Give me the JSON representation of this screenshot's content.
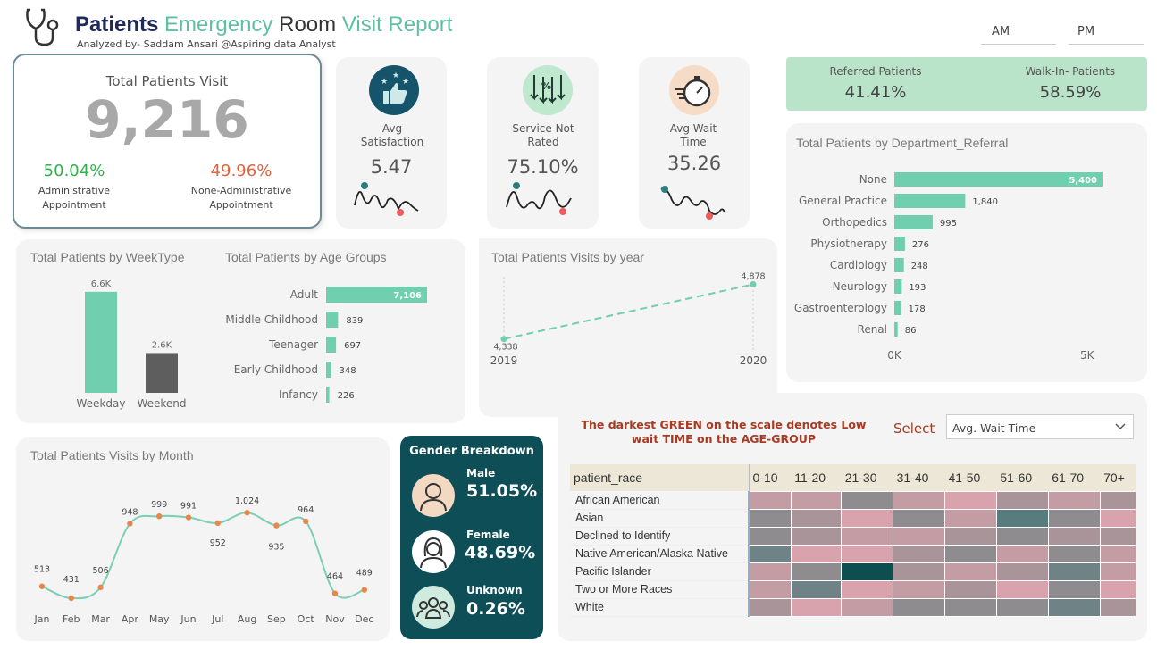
{
  "header": {
    "title_w1": "Patients",
    "title_w2": "Emergency",
    "title_w3": "Room",
    "title_w4": "Visit Report",
    "subtitle": "Analyzed by- Saddam Ansari @Aspiring data Analyst",
    "slicer_am": "AM",
    "slicer_pm": "PM",
    "colors": {
      "navy": "#1e2a5a",
      "teal": "#5fbfa4"
    }
  },
  "total": {
    "title": "Total Patients Visit",
    "value": "9,216",
    "admin_pct": "50.04%",
    "admin_label": "Administrative Appointment",
    "nonadmin_pct": "49.96%",
    "nonadmin_label": "None-Administrative Appointment"
  },
  "kpis": [
    {
      "label": "Avg Satisfaction",
      "value": "5.47",
      "icon": "thumbs-up-stars-icon"
    },
    {
      "label": "Service Not Rated",
      "value": "75.10%",
      "icon": "percent-arrows-icon"
    },
    {
      "label": "Avg Wait Time",
      "value": "35.26",
      "icon": "stopwatch-icon"
    }
  ],
  "referral": {
    "referred_label": "Referred Patients",
    "referred_value": "41.41%",
    "walkin_label": "Walk-In- Patients",
    "walkin_value": "58.59%"
  },
  "gender": {
    "title": "Gender Breakdown",
    "male_label": "Male",
    "male_value": "51.05%",
    "female_label": "Female",
    "female_value": "48.69%",
    "unknown_label": "Unknown",
    "unknown_value": "0.26%"
  },
  "heatmap": {
    "note": "The darkest GREEN on the scale denotes Low wait TIME on the AGE-GROUP",
    "select_label": "Select",
    "select_value": "Avg. Wait Time",
    "row_header": "patient_race",
    "columns": [
      "0-10",
      "11-20",
      "21-30",
      "31-40",
      "41-50",
      "51-60",
      "61-70",
      "70+"
    ],
    "rows": [
      "African American",
      "Asian",
      "Declined to Identify",
      "Native American/Alaska Native",
      "Pacific Islander",
      "Two or More Races",
      "White"
    ],
    "levels": [
      [
        2,
        2,
        4,
        2,
        1,
        3,
        2,
        3
      ],
      [
        4,
        3,
        1,
        4,
        2,
        6,
        4,
        1
      ],
      [
        4,
        3,
        2,
        2,
        3,
        4,
        3,
        3
      ],
      [
        5,
        1,
        1,
        3,
        4,
        2,
        4,
        2
      ],
      [
        2,
        4,
        7,
        3,
        2,
        3,
        5,
        2
      ],
      [
        2,
        5,
        1,
        2,
        3,
        1,
        4,
        1
      ],
      [
        3,
        1,
        2,
        4,
        4,
        4,
        5,
        3
      ]
    ],
    "colors": [
      "#e9a9b6",
      "#d9a3ae",
      "#c49da4",
      "#a99599",
      "#8e8c8f",
      "#6f8386",
      "#567c7d",
      "#0d4f50"
    ]
  },
  "chart_data": [
    {
      "type": "bar",
      "title": "Total Patients by WeekType",
      "categories": [
        "Weekday",
        "Weekend"
      ],
      "values": [
        6600,
        2600
      ],
      "value_labels": [
        "6.6K",
        "2.6K"
      ],
      "colors": [
        "#6fcfae",
        "#5e5e5e"
      ]
    },
    {
      "type": "bar",
      "orientation": "horizontal",
      "title": "Total Patients by Age Groups",
      "categories": [
        "Adult",
        "Middle Childhood",
        "Teenager",
        "Early Childhood",
        "Infancy"
      ],
      "values": [
        7106,
        839,
        697,
        348,
        226
      ],
      "value_labels": [
        "7,106",
        "839",
        "697",
        "348",
        "226"
      ]
    },
    {
      "type": "line",
      "title": "Total Patients Visits by year",
      "x": [
        "2019",
        "2020"
      ],
      "values": [
        4338,
        4878
      ],
      "value_labels": [
        "4,338",
        "4,878"
      ]
    },
    {
      "type": "bar",
      "orientation": "horizontal",
      "title": "Total Patients by Department_Referral",
      "categories": [
        "None",
        "General Practice",
        "Orthopedics",
        "Physiotherapy",
        "Cardiology",
        "Neurology",
        "Gastroenterology",
        "Renal"
      ],
      "values": [
        5400,
        1840,
        995,
        276,
        248,
        193,
        178,
        86
      ],
      "value_labels": [
        "5,400",
        "1,840",
        "995",
        "276",
        "248",
        "193",
        "178",
        "86"
      ],
      "tick_labels": [
        "0K",
        "5K"
      ]
    },
    {
      "type": "line",
      "title": "Total Patients Visits by Month",
      "x": [
        "Jan",
        "Feb",
        "Mar",
        "Apr",
        "May",
        "Jun",
        "Jul",
        "Aug",
        "Sep",
        "Oct",
        "Nov",
        "Dec"
      ],
      "values": [
        513,
        431,
        506,
        948,
        999,
        991,
        952,
        1024,
        935,
        964,
        464,
        489
      ],
      "value_labels": [
        "513",
        "431",
        "506",
        "948",
        "999",
        "991",
        "952",
        "1,024",
        "935",
        "964",
        "464",
        "489"
      ]
    }
  ]
}
